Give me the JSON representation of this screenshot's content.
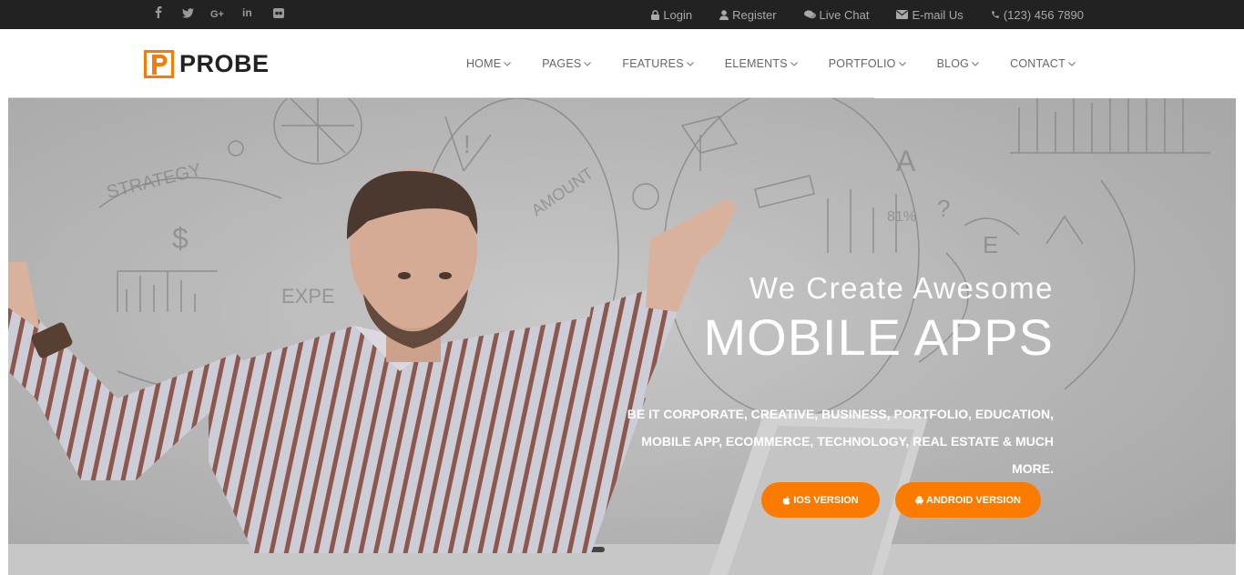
{
  "topbar": {
    "socials": [
      {
        "icon": "facebook-icon",
        "glyph": "f"
      },
      {
        "icon": "twitter-icon",
        "glyph": "🐦"
      },
      {
        "icon": "google-plus-icon",
        "glyph": "G+"
      },
      {
        "icon": "linkedin-icon",
        "glyph": "in"
      },
      {
        "icon": "flickr-icon",
        "glyph": "●●"
      }
    ],
    "links": {
      "login": "Login",
      "register": "Register",
      "live_chat": "Live Chat",
      "email": "E-mail Us",
      "phone": "(123) 456 7890"
    }
  },
  "header": {
    "logo_text": "PROBE",
    "nav": {
      "home": "HOME",
      "pages": "PAGES",
      "features": "FEATURES",
      "elements": "ELEMENTS",
      "portfolio": "PORTFOLIO",
      "blog": "BLOG",
      "contact": "CONTACT"
    }
  },
  "hero": {
    "subtitle": "We Create Awesome",
    "title": "MOBILE APPS",
    "desc_line1": "BE IT CORPORATE, CREATIVE, BUSINESS, PORTFOLIO, EDUCATION,",
    "desc_line2": "MOBILE APP, ECOMMERCE, TECHNOLOGY, REAL ESTATE & MUCH MORE.",
    "btn_ios": "IOS VERSION",
    "btn_android": "ANDROID VERSION"
  },
  "colors": {
    "accent": "#fa7b00",
    "topbar_bg": "#222222",
    "nav_text": "#666666"
  }
}
